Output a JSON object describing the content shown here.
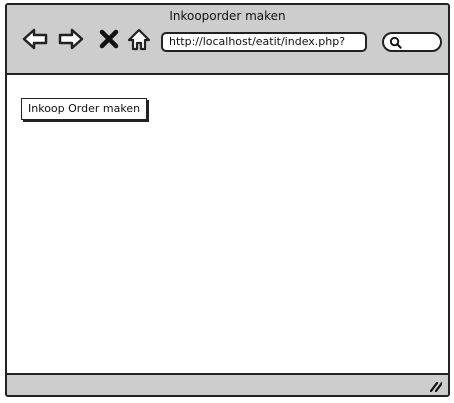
{
  "window": {
    "title": "Inkooporder maken"
  },
  "toolbar": {
    "back_icon": "back-arrow-icon",
    "forward_icon": "forward-arrow-icon",
    "stop_icon": "close-x-icon",
    "home_icon": "home-icon",
    "address_url": "http://localhost/eatit/index.php?",
    "search_icon": "search-icon"
  },
  "content": {
    "button_label": "Inkoop Order maken"
  },
  "statusbar": {
    "grip_icon": "resize-grip-icon"
  }
}
